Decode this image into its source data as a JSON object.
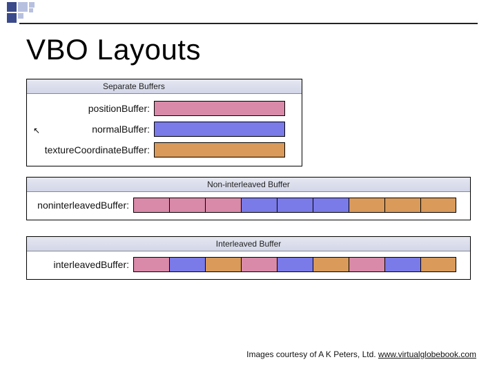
{
  "title": "VBO Layouts",
  "panels": {
    "separate": {
      "header": "Separate Buffers",
      "rows": [
        {
          "label": "positionBuffer:",
          "color": "pink"
        },
        {
          "label": "normalBuffer:",
          "color": "blue"
        },
        {
          "label": "textureCoordinateBuffer:",
          "color": "orange"
        }
      ]
    },
    "noninterleaved": {
      "header": "Non-interleaved Buffer",
      "label": "noninterleavedBuffer:",
      "segments": [
        "pink",
        "pink",
        "pink",
        "blue",
        "blue",
        "blue",
        "orange",
        "orange",
        "orange"
      ]
    },
    "interleaved": {
      "header": "Interleaved Buffer",
      "label": "interleavedBuffer:",
      "segments": [
        "pink",
        "blue",
        "orange",
        "pink",
        "blue",
        "orange",
        "pink",
        "blue",
        "orange"
      ]
    }
  },
  "credit": {
    "prefix": "Images courtesy of A K Peters, Ltd. ",
    "link": "www.virtualglobebook.com"
  },
  "colors": {
    "pink": "#d98aa8",
    "blue": "#7a7ae8",
    "orange": "#d99a5a"
  }
}
